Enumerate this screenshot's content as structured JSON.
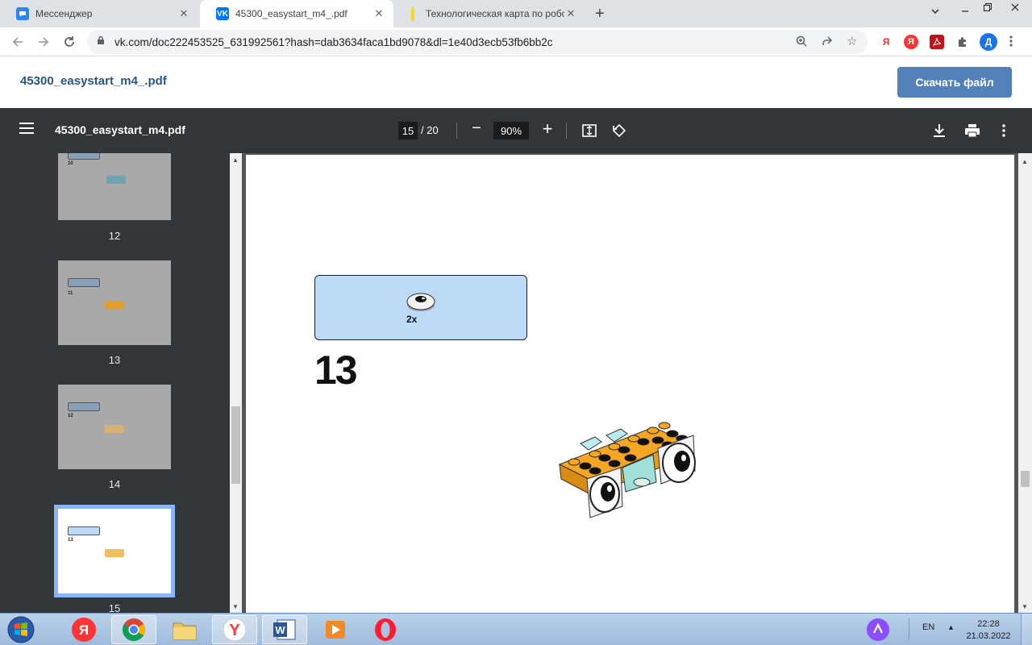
{
  "browser": {
    "tabs": [
      {
        "title": "Мессенджер",
        "favicon": "vk-messenger-icon",
        "active": false
      },
      {
        "title": "45300_easystart_m4_.pdf",
        "favicon": "vk-icon",
        "active": true
      },
      {
        "title": "Технологическая карта по робо",
        "favicon": "doc-icon",
        "active": false
      }
    ],
    "url": "vk.com/doc222453525_631992561?hash=dab3634faca1bd9078&dl=1e40d3ecb53fb6bb2c",
    "profile_initial": "Д",
    "yandex_label": "Я"
  },
  "vk": {
    "doc_title": "45300_easystart_m4_.pdf",
    "download_label": "Скачать файл"
  },
  "pdf": {
    "filename": "45300_easystart_m4.pdf",
    "current_page": "15",
    "total_pages": "/ 20",
    "zoom": "90%",
    "thumbnails": [
      {
        "label": "12",
        "step": "10"
      },
      {
        "label": "13",
        "step": "11"
      },
      {
        "label": "14",
        "step": "12"
      },
      {
        "label": "15",
        "step": "13",
        "selected": true
      }
    ],
    "page": {
      "step_number": "13",
      "part_quantity": "2x"
    }
  },
  "taskbar": {
    "language": "EN",
    "time": "22:28",
    "date": "21.03.2022"
  },
  "colors": {
    "vk_blue": "#5181b8",
    "pdf_toolbar": "#323639",
    "parts_box": "#bcd9f5",
    "lego_orange": "#f5a623"
  }
}
